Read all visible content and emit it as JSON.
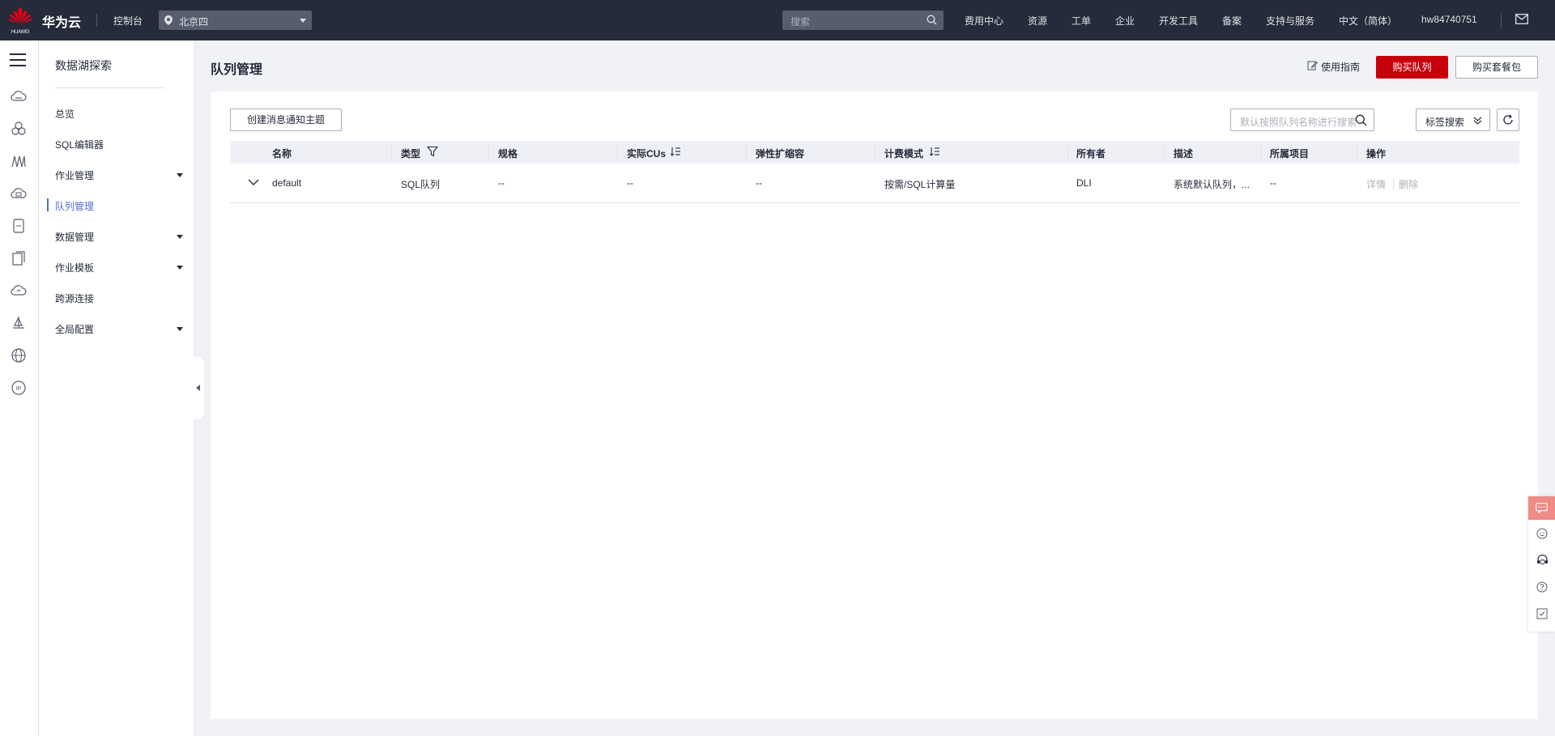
{
  "topbar": {
    "logo_text": "HUAWEI",
    "brand": "华为云",
    "console": "控制台",
    "region": "北京四",
    "search_placeholder": "搜索",
    "nav": [
      "费用中心",
      "资源",
      "工单",
      "企业",
      "开发工具",
      "备案",
      "支持与服务",
      "中文（简体）",
      "hw84740751"
    ]
  },
  "service_nav": {
    "title": "数据湖探索",
    "items": [
      "总览",
      "SQL编辑器",
      "作业管理",
      "队列管理",
      "数据管理",
      "作业模板",
      "跨源连接",
      "全局配置"
    ]
  },
  "page": {
    "title": "队列管理",
    "guide_label": "使用指南",
    "buy_queue_label": "购买队列",
    "buy_package_label": "购买套餐包",
    "create_topic_label": "创建消息通知主题",
    "search_placeholder": "默认按照队列名称进行搜索",
    "tag_search_label": "标签搜索"
  },
  "table": {
    "columns": [
      "名称",
      "类型",
      "规格",
      "实际CUs",
      "弹性扩缩容",
      "计费模式",
      "所有者",
      "描述",
      "所属项目",
      "操作"
    ],
    "rows": [
      {
        "name": "default",
        "type": "SQL队列",
        "spec": "--",
        "actual_cus": "--",
        "elastic": "--",
        "billing": "按需/SQL计算量",
        "owner": "DLI",
        "description": "系统默认队列，...",
        "project": "--",
        "op_detail": "详情",
        "op_delete": "删除"
      }
    ]
  },
  "colors": {
    "topbar_bg": "#252b3a",
    "brand_red": "#c7000b",
    "active_blue": "#526ecc",
    "chat_float": "#ef8a84"
  }
}
